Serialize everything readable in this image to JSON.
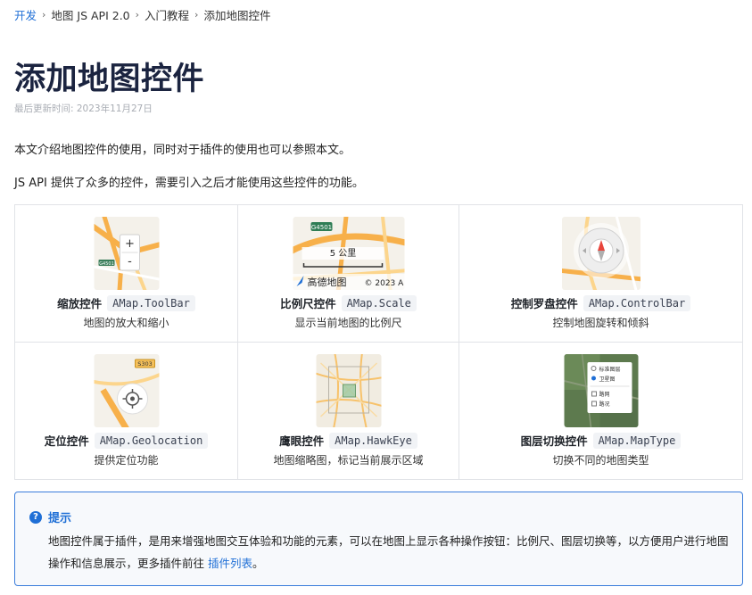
{
  "breadcrumb": {
    "items": [
      "开发",
      "地图 JS API 2.0",
      "入门教程",
      "添加地图控件"
    ],
    "separator": "›"
  },
  "page": {
    "title": "添加地图控件",
    "updated": "最后更新时间: 2023年11月27日",
    "intro1": "本文介绍地图控件的使用，同时对于插件的使用也可以参照本文。",
    "intro2": "JS API 提供了众多的控件，需要引入之后才能使用这些控件的功能。"
  },
  "controls": [
    {
      "name": "缩放控件",
      "code": "AMap.ToolBar",
      "desc": "地图的放大和缩小",
      "icon": "toolbar-thumbnail",
      "thumb": {
        "plus": "+",
        "minus": "-",
        "road": "G4501"
      }
    },
    {
      "name": "比例尺控件",
      "code": "AMap.Scale",
      "desc": "显示当前地图的比例尺",
      "icon": "scale-thumbnail",
      "thumb": {
        "road": "G4501",
        "scale": "5 公里",
        "logo": "高德地图",
        "copyright": "© 2023 A"
      }
    },
    {
      "name": "控制罗盘控件",
      "code": "AMap.ControlBar",
      "desc": "控制地图旋转和倾斜",
      "icon": "compass-thumbnail",
      "thumb": {}
    },
    {
      "name": "定位控件",
      "code": "AMap.Geolocation",
      "desc": "提供定位功能",
      "icon": "geolocation-thumbnail",
      "thumb": {
        "road": "S303"
      }
    },
    {
      "name": "鹰眼控件",
      "code": "AMap.HawkEye",
      "desc": "地图缩略图，标记当前展示区域",
      "icon": "hawkeye-thumbnail",
      "thumb": {}
    },
    {
      "name": "图层切换控件",
      "code": "AMap.MapType",
      "desc": "切换不同的地图类型",
      "icon": "maptype-thumbnail",
      "thumb": {
        "opt1": "标准图层",
        "opt2": "卫星图",
        "opt3": "路网",
        "opt4": "路况"
      }
    }
  ],
  "tip": {
    "title": "提示",
    "icon": "question-circle-icon",
    "body_prefix": "地图控件属于插件，是用来增强地图交互体验和功能的元素，可以在地图上显示各种操作按钮：比例尺、图层切换等，以方便用户进行地图操作和信息展示，更多插件前往 ",
    "link": "插件列表",
    "body_suffix": "。"
  },
  "colors": {
    "link": "#1f6fd6",
    "title": "#1b2440",
    "border": "#e1e3e7",
    "tip_border": "#3b7ddb"
  }
}
